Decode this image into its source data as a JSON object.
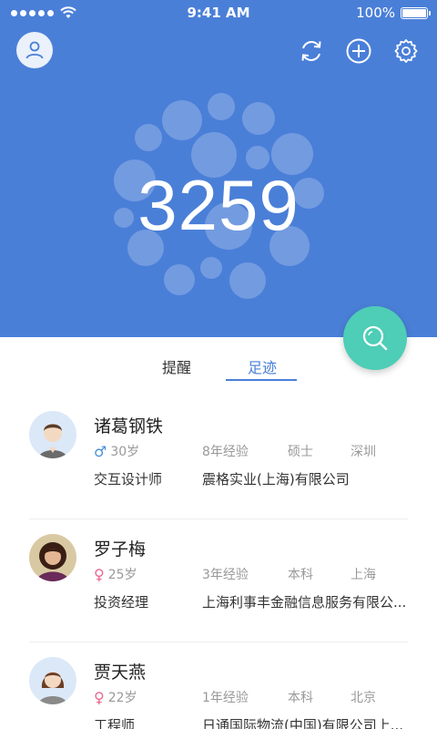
{
  "status_bar": {
    "time": "9:41 AM",
    "battery": "100%"
  },
  "hero": {
    "count": "3259"
  },
  "tabs": [
    {
      "label": "提醒"
    },
    {
      "label": "足迹"
    }
  ],
  "people": [
    {
      "name": "诸葛钢铁",
      "gender": "male",
      "gender_symbol": "♂",
      "age": "30岁",
      "experience": "8年经验",
      "education": "硕士",
      "city": "深圳",
      "job": "交互设计师",
      "company": "震格实业(上海)有限公司"
    },
    {
      "name": "罗子梅",
      "gender": "female",
      "gender_symbol": "♀",
      "age": "25岁",
      "experience": "3年经验",
      "education": "本科",
      "city": "上海",
      "job": "投资经理",
      "company": "上海利事丰金融信息服务有限公..."
    },
    {
      "name": "贾天燕",
      "gender": "female",
      "gender_symbol": "♀",
      "age": "22岁",
      "experience": "1年经验",
      "education": "本科",
      "city": "北京",
      "job": "工程师",
      "company": "日通国际物流(中国)有限公司上..."
    }
  ],
  "colors": {
    "primary": "#4a7fd8",
    "fab": "#4ecdb7",
    "male": "#4a90d9",
    "female": "#e7688f"
  }
}
